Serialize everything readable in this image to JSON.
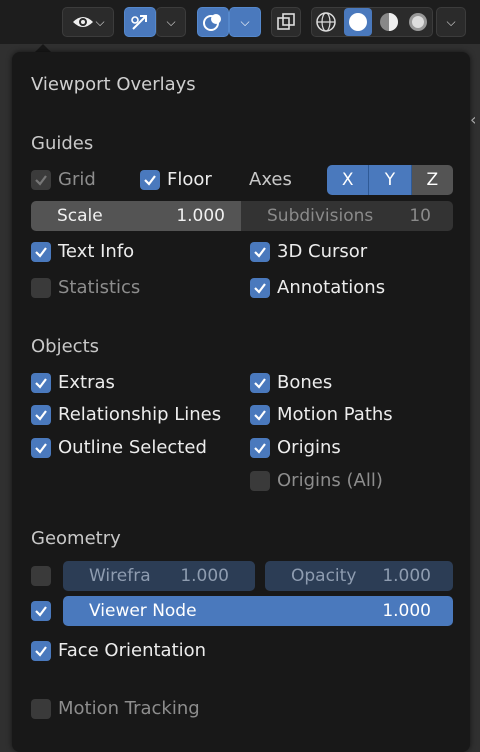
{
  "toolbar": {
    "view_icon": "eye-icon",
    "gizmo_icon": "gizmo-arrow-icon",
    "overlay_icon": "overlays-icon",
    "xray_icon": "xray-icon",
    "shading_modes": [
      "wireframe-icon",
      "solid-icon",
      "material-preview-icon",
      "rendered-icon"
    ]
  },
  "panel": {
    "title": "Viewport Overlays",
    "guides": {
      "heading": "Guides",
      "grid": "Grid",
      "floor": "Floor",
      "axes_label": "Axes",
      "axes": [
        "X",
        "Y",
        "Z"
      ],
      "scale_label": "Scale",
      "scale_value": "1.000",
      "subdivisions_label": "Subdivisions",
      "subdivisions_value": "10",
      "text_info": "Text Info",
      "cursor": "3D Cursor",
      "statistics": "Statistics",
      "annotations": "Annotations"
    },
    "objects": {
      "heading": "Objects",
      "extras": "Extras",
      "bones": "Bones",
      "relationship_lines": "Relationship Lines",
      "motion_paths": "Motion Paths",
      "outline_selected": "Outline Selected",
      "origins": "Origins",
      "origins_all": "Origins (All)"
    },
    "geometry": {
      "heading": "Geometry",
      "wireframe_label": "Wirefra",
      "wireframe_value": "1.000",
      "opacity_label": "Opacity",
      "opacity_value": "1.000",
      "viewer_node_label": "Viewer Node",
      "viewer_node_value": "1.000",
      "face_orientation": "Face Orientation"
    },
    "motion_tracking": "Motion Tracking"
  },
  "colors": {
    "accent": "#4a79bd",
    "panel": "#181818",
    "checkbox_off": "#545454"
  }
}
